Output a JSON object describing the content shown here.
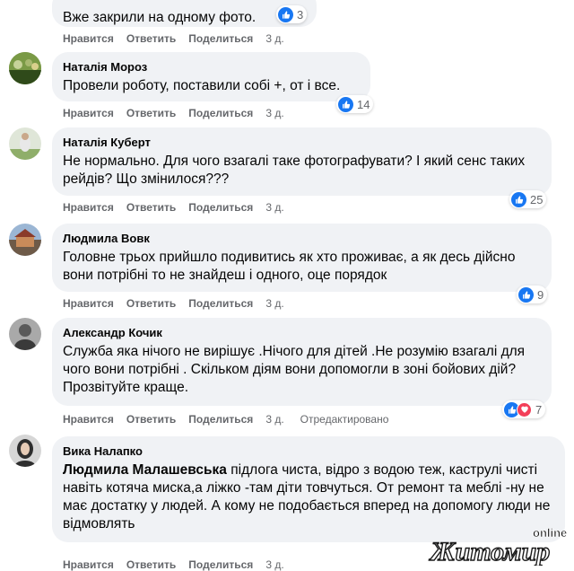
{
  "labels": {
    "like": "Нравится",
    "reply": "Ответить",
    "share": "Поделиться"
  },
  "comments": [
    {
      "author": "",
      "text": "Вже закрили на одному фото.",
      "time": "3 д.",
      "reactions": "3",
      "edited": ""
    },
    {
      "author": "Наталія Мороз",
      "text": "Провели роботу, поставили собі +, от і все.",
      "time": "3 д.",
      "reactions": "14",
      "edited": ""
    },
    {
      "author": "Наталія Куберт",
      "text": "Не нормально. Для чого взагалі таке фотографувати? І який сенс таких рейдів? Що змінилося???",
      "time": "3 д.",
      "reactions": "25",
      "edited": ""
    },
    {
      "author": "Людмила Вовк",
      "text": "Головне трьох прийшло подивитись як хто проживає, а як десь дійсно вони потрібні то не знайдеш і одного, оце порядок",
      "time": "3 д.",
      "reactions": "9",
      "edited": ""
    },
    {
      "author": "Александр Кочик",
      "text": "Служба яка нічого не вирішує .Нічого для дітей .Не розумію взагалі для чого вони потрібні . Скільком діям вони допомогли в зоні бойових дій? Прозвітуйте краще.",
      "time": "3 д.",
      "reactions": "7",
      "edited": "Отредактировано"
    },
    {
      "author": "Вика Налапко",
      "mention": "Людмила Малашевська",
      "text": " підлога чиста, відро з водою теж, каструлі чисті навіть котяча миска,а ліжко -там діти товчуться. От ремонт та меблі -ну не має достатку у людей. А кому не подобається вперед на допомогу люди не відмовлять",
      "time": "3 д.",
      "reactions": "",
      "edited": ""
    }
  ],
  "logo": {
    "name": "Житомир",
    "suffix": "online"
  },
  "colors": {
    "bubble": "#f0f2f5",
    "meta": "#65676b",
    "like": "#1877f2",
    "love": "#f33e58"
  }
}
